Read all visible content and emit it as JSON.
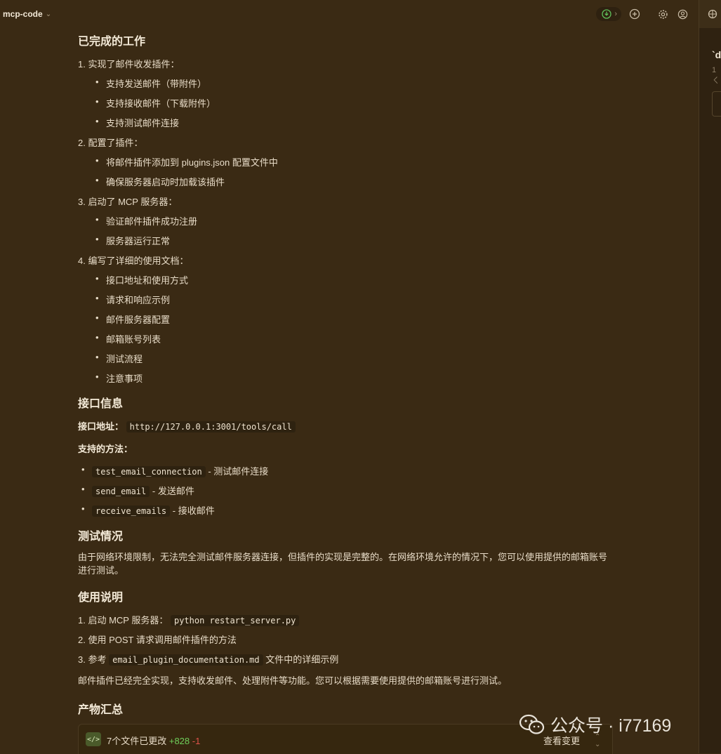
{
  "header": {
    "project_name": "mcp-code"
  },
  "sections": {
    "done_title": "已完成的工作",
    "items": [
      {
        "num": "1.",
        "text": "实现了邮件收发插件：",
        "bullets": [
          "支持发送邮件（带附件）",
          "支持接收邮件（下载附件）",
          "支持测试邮件连接"
        ]
      },
      {
        "num": "2.",
        "text": "配置了插件：",
        "bullets": [
          "将邮件插件添加到 plugins.json 配置文件中",
          "确保服务器启动时加载该插件"
        ]
      },
      {
        "num": "3.",
        "text": "启动了 MCP 服务器：",
        "bullets": [
          "验证邮件插件成功注册",
          "服务器运行正常"
        ]
      },
      {
        "num": "4.",
        "text": "编写了详细的使用文档：",
        "bullets": [
          "接口地址和使用方式",
          "请求和响应示例",
          "邮件服务器配置",
          "邮箱账号列表",
          "测试流程",
          "注意事项"
        ]
      }
    ],
    "api_title": "接口信息",
    "api_addr_label": "接口地址：",
    "api_addr": "http://127.0.0.1:3001/tools/call",
    "methods_label": "支持的方法：",
    "methods": [
      {
        "code": "test_email_connection",
        "desc": "- 测试邮件连接"
      },
      {
        "code": "send_email",
        "desc": "- 发送邮件"
      },
      {
        "code": "receive_emails",
        "desc": "- 接收邮件"
      }
    ],
    "test_title": "测试情况",
    "test_text": "由于网络环境限制，无法完全测试邮件服务器连接，但插件的实现是完整的。在网络环境允许的情况下，您可以使用提供的邮箱账号进行测试。",
    "usage_title": "使用说明",
    "usage": [
      {
        "num": "1.",
        "pre": "启动 MCP 服务器：",
        "code": "python restart_server.py",
        "post": ""
      },
      {
        "num": "2.",
        "pre": "使用 POST 请求调用邮件插件的方法",
        "code": "",
        "post": ""
      },
      {
        "num": "3.",
        "pre": "参考",
        "code": "email_plugin_documentation.md",
        "post": "文件中的详细示例"
      }
    ],
    "summary_text": "邮件插件已经完全实现，支持收发邮件、处理附件等功能。您可以根据需要使用提供的邮箱账号进行测试。",
    "artifacts_title": "产物汇总"
  },
  "changes": {
    "files_changed": "7个文件已更改",
    "added": "+828",
    "removed": "-1",
    "view_label": "查看变更"
  },
  "right_panel": {
    "title": "`d",
    "subtitle": "1 ㄑ"
  },
  "watermark": "公众号 · i77169",
  "icons": [
    "chevron-down-icon",
    "download-icon",
    "chevron-right-icon",
    "new-chat-icon",
    "settings-icon",
    "account-icon",
    "crosshair-icon"
  ],
  "colors": {
    "background": "#3a2a14",
    "accent_add": "#6fcf5a",
    "accent_del": "#e0524a"
  }
}
